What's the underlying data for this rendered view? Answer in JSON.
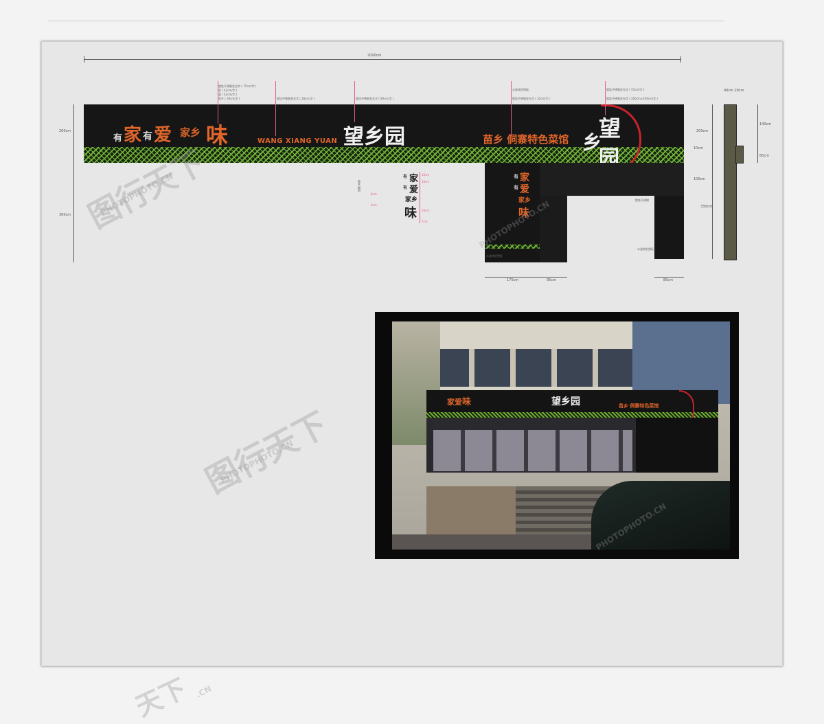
{
  "dimensions": {
    "overall_width_top": "2000cm",
    "overall_width": "2000cm",
    "left_height_top": "200cm",
    "left_height_bottom": "300cm",
    "right_h1": "200cm",
    "right_h2": "10cm",
    "right_h3": "100cm",
    "right_h4": "330cm",
    "side_w": "40cm 20cm",
    "side_h1": "140cm",
    "side_h2": "80cm",
    "bottom_w1": "175cm",
    "bottom_w2": "95cm",
    "bottom_w3": "85cm"
  },
  "annotations": {
    "a1": "镀钛不锈钢发光字 ( 75cm/字 )",
    "a2": "家 ( 42cm/字 )",
    "a3": "爱 ( 42cm/字 )",
    "a4": "家乡 ( 30cm/字 )",
    "a5": "镀钛不锈钢发光字 ( 28cm/字 )",
    "a6": "镀钛不锈钢发光字 ( 80cm/字 )",
    "a7": "水波纹铝塑板",
    "a8": "镀钛不锈钢发光字 ( 35cm/字 )",
    "a9": "镀钛不锈钢发光字 ( 55cm/字 )",
    "a10": "镀钛不锈钢发光字 ( 200cm×236cm/字 )",
    "a11": "镀钛不锈钢",
    "a12": "水波纹铝塑板",
    "a13": "水波纹铝塑板",
    "v1": "镀钛 雕刻",
    "v2": "15cm",
    "v3": "8cm",
    "v4": "20cm",
    "v5": "9cm",
    "v6": "20cm",
    "v7": "7cm"
  },
  "sign": {
    "slogan_you1": "有",
    "slogan_jia": "家",
    "slogan_you2": "有",
    "slogan_ai": "爱",
    "slogan_jiaxiang": "家乡",
    "slogan_wei": "味",
    "pinyin": "WANG XIANG YUAN",
    "brand": "望乡园",
    "tagline": "苗乡 侗寨特色菜馆",
    "logo_a": "乡",
    "logo_b": "望",
    "logo_c": "园"
  },
  "vertical_sign": {
    "t1": "有",
    "t2": "家",
    "t3": "有",
    "t4": "爱",
    "t5": "家乡",
    "t6": "味"
  },
  "watermarks": {
    "cn": "图行天下",
    "en": "PHOTOPHOTO.CN",
    "cn2": "图行天下",
    "en2": "PHOTOPHOTO.CN",
    "en3": "PHOTOPHOTO.CN",
    "en4": "PHOTOPHOTO.CN",
    "cn_bottom": "天下",
    "en_bottom": ".CN"
  },
  "colors": {
    "sign_bg": "#161616",
    "accent_orange": "#e0662a",
    "accent_red": "#c8232b",
    "pattern_green": "#6fae33",
    "dimension_pink": "#e45b8c"
  }
}
